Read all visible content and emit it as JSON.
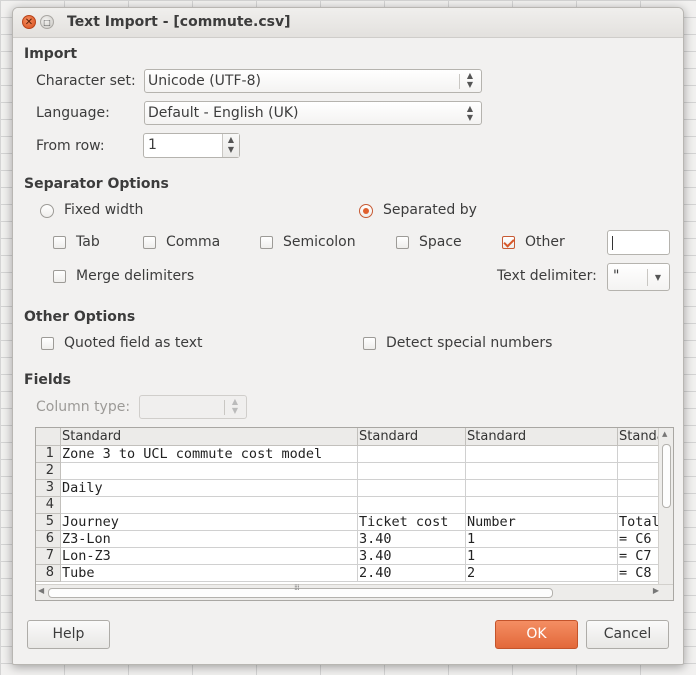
{
  "window": {
    "title": "Text Import - [commute.csv]",
    "close_glyph": "✕",
    "maximize_glyph": "□"
  },
  "import": {
    "heading": "Import",
    "charset_label": "Character set:",
    "charset_value": "Unicode (UTF-8)",
    "language_label": "Language:",
    "language_value": "Default - English (UK)",
    "from_row_label": "From row:",
    "from_row_value": "1"
  },
  "separator": {
    "heading": "Separator Options",
    "fixed_width": "Fixed width",
    "separated_by": "Separated by",
    "selected": "Separated by",
    "tab": "Tab",
    "tab_checked": false,
    "comma": "Comma",
    "comma_checked": false,
    "semicolon": "Semicolon",
    "semicolon_checked": false,
    "space": "Space",
    "space_checked": false,
    "other": "Other",
    "other_checked": true,
    "other_value": "",
    "merge": "Merge delimiters",
    "merge_checked": false,
    "text_delim_label": "Text delimiter:",
    "text_delim_value": "\""
  },
  "other_options": {
    "heading": "Other Options",
    "quoted": "Quoted field as text",
    "quoted_checked": false,
    "detect": "Detect special numbers",
    "detect_checked": false
  },
  "fields": {
    "heading": "Fields",
    "column_type_label": "Column type:",
    "column_type_value": "",
    "columns": [
      "Standard",
      "Standard",
      "Standard",
      "Standard"
    ],
    "rows": [
      {
        "num": "1",
        "cells": [
          "Zone 3 to UCL commute cost model",
          "",
          "",
          ""
        ]
      },
      {
        "num": "2",
        "cells": [
          "",
          "",
          "",
          ""
        ]
      },
      {
        "num": "3",
        "cells": [
          "Daily",
          "",
          "",
          ""
        ]
      },
      {
        "num": "4",
        "cells": [
          "",
          "",
          "",
          ""
        ]
      },
      {
        "num": "5",
        "cells": [
          "Journey",
          "Ticket cost",
          "Number",
          "Total"
        ]
      },
      {
        "num": "6",
        "cells": [
          "Z3-Lon",
          "3.40",
          "1",
          "= C6"
        ]
      },
      {
        "num": "7",
        "cells": [
          "Lon-Z3",
          "3.40",
          "1",
          "= C7"
        ]
      },
      {
        "num": "8",
        "cells": [
          "Tube",
          "2.40",
          "2",
          "= C8"
        ]
      }
    ]
  },
  "buttons": {
    "help": "Help",
    "ok": "OK",
    "cancel": "Cancel"
  },
  "colors": {
    "accent": "#e2683a",
    "check": "#d8582a"
  }
}
